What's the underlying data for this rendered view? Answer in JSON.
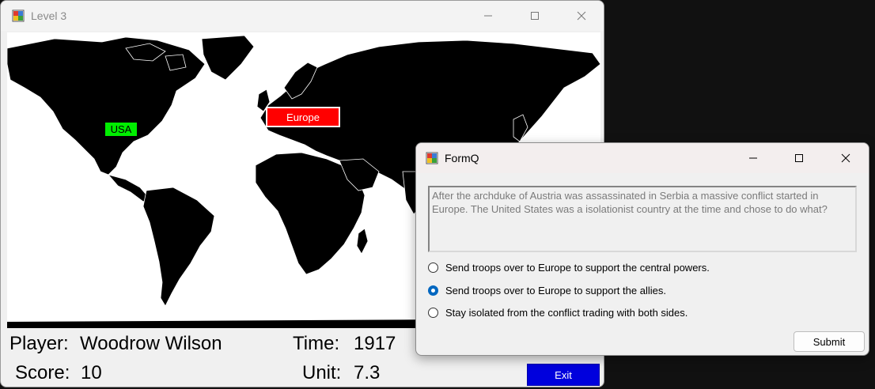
{
  "main_window": {
    "title": "Level 3",
    "map_labels": {
      "usa": "USA",
      "europe": "Europe"
    },
    "stats": {
      "player_label": "Player:",
      "player_value": "Woodrow Wilson",
      "score_label": "Score:",
      "score_value": "10",
      "time_label": "Time:",
      "time_value": "1917",
      "unit_label": "Unit:",
      "unit_value": "7.3"
    },
    "exit_label": "Exit"
  },
  "dialog": {
    "title": "FormQ",
    "question": "After the archduke of Austria was assassinated in Serbia a massive conflict started in Europe. The United States was a isolationist country at the time and chose to do what?",
    "options": [
      {
        "label": "Send troops over to Europe to support the central powers.",
        "selected": false
      },
      {
        "label": "Send troops over to Europe to support the allies.",
        "selected": true
      },
      {
        "label": "Stay isolated from the conflict trading with both sides.",
        "selected": false
      }
    ],
    "submit_label": "Submit"
  },
  "colors": {
    "usa_label_bg": "#00ee00",
    "europe_label_bg": "#ff0000",
    "exit_button_bg": "#0000dd",
    "radio_selected": "#0067c0"
  }
}
